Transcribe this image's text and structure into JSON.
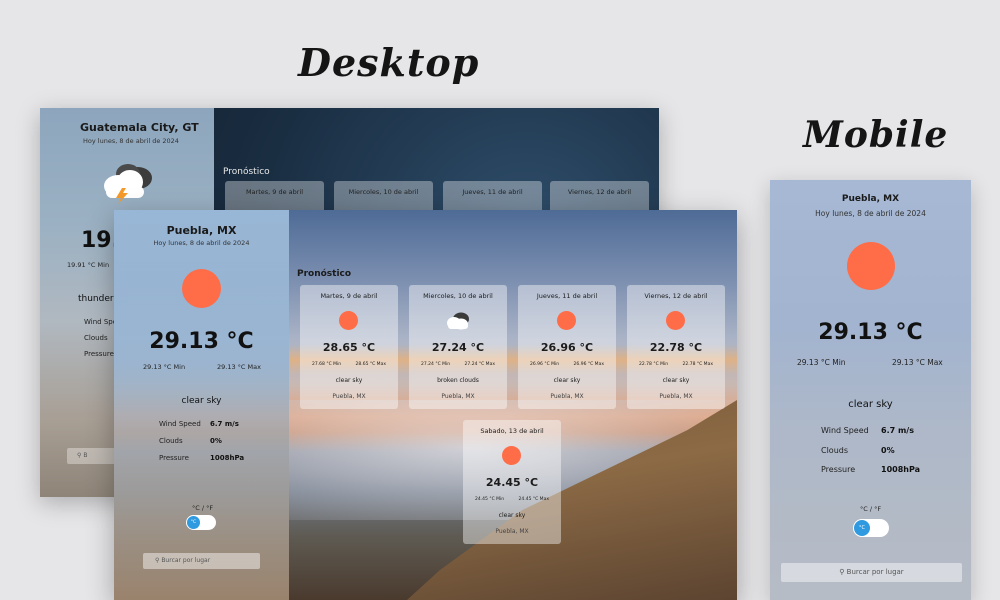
{
  "headings": {
    "desktop": "Desktop",
    "mobile": "Mobile"
  },
  "back_app": {
    "city": "Guatemala City, GT",
    "date": "Hoy lunes, 8 de abril de 2024",
    "temp": "19.",
    "min": "19.91 °C Min",
    "description": "thunders",
    "labels": [
      "Wind Spe",
      "Clouds",
      "Pressure"
    ],
    "search_placeholder": "B",
    "forecast_title": "Pronóstico",
    "forecast_days": [
      "Martes, 9 de abril",
      "Miercoles, 10 de abril",
      "Jueves, 11 de abril",
      "Viernes, 12 de abril"
    ]
  },
  "front_app": {
    "city": "Puebla, MX",
    "date": "Hoy lunes, 8 de abril de 2024",
    "temp": "29.13 °C",
    "min": "29.13 °C Min",
    "max": "29.13 °C Max",
    "description": "clear sky",
    "details": [
      {
        "label": "Wind Speed",
        "value": "6.7 m/s"
      },
      {
        "label": "Clouds",
        "value": "0%"
      },
      {
        "label": "Pressure",
        "value": "1008hPa"
      }
    ],
    "unit_toggle_label": "°C / °F",
    "unit_toggle_value": "°C",
    "search_placeholder": "Burcar por lugar",
    "forecast_title": "Pronóstico",
    "forecast": [
      {
        "day": "Martes, 9 de abril",
        "icon": "sun-icon",
        "temp": "28.65 °C",
        "min": "27.68 °C Min",
        "max": "28.65 °C Max",
        "desc": "clear sky",
        "city": "Puebla, MX"
      },
      {
        "day": "Miercoles, 10 de abril",
        "icon": "broken-clouds-icon",
        "temp": "27.24 °C",
        "min": "27.24 °C Min",
        "max": "27.24 °C Max",
        "desc": "broken clouds",
        "city": "Puebla, MX"
      },
      {
        "day": "Jueves, 11 de abril",
        "icon": "sun-icon",
        "temp": "26.96 °C",
        "min": "26.96 °C Min",
        "max": "26.96 °C Max",
        "desc": "clear sky",
        "city": "Puebla, MX"
      },
      {
        "day": "Viernes, 12 de abril",
        "icon": "sun-icon",
        "temp": "22.78 °C",
        "min": "22.78 °C Min",
        "max": "22.78 °C Max",
        "desc": "clear sky",
        "city": "Puebla, MX"
      },
      {
        "day": "Sabado, 13 de abril",
        "icon": "sun-icon",
        "temp": "24.45 °C",
        "min": "24.45 °C Min",
        "max": "24.45 °C Max",
        "desc": "clear sky",
        "city": "Puebla, MX"
      }
    ]
  },
  "mobile_app": {
    "city": "Puebla, MX",
    "date": "Hoy lunes, 8 de abril de 2024",
    "temp": "29.13 °C",
    "min": "29.13 °C Min",
    "max": "29.13 °C Max",
    "description": "clear sky",
    "details": [
      {
        "label": "Wind Speed",
        "value": "6.7 m/s"
      },
      {
        "label": "Clouds",
        "value": "0%"
      },
      {
        "label": "Pressure",
        "value": "1008hPa"
      }
    ],
    "unit_toggle_label": "°C / °F",
    "unit_toggle_value": "°C",
    "search_placeholder": "Burcar por lugar"
  },
  "colors": {
    "sun": "#ff6c48",
    "toggle_knob": "#2f9ae0",
    "page_bg": "#e6e6e8"
  }
}
